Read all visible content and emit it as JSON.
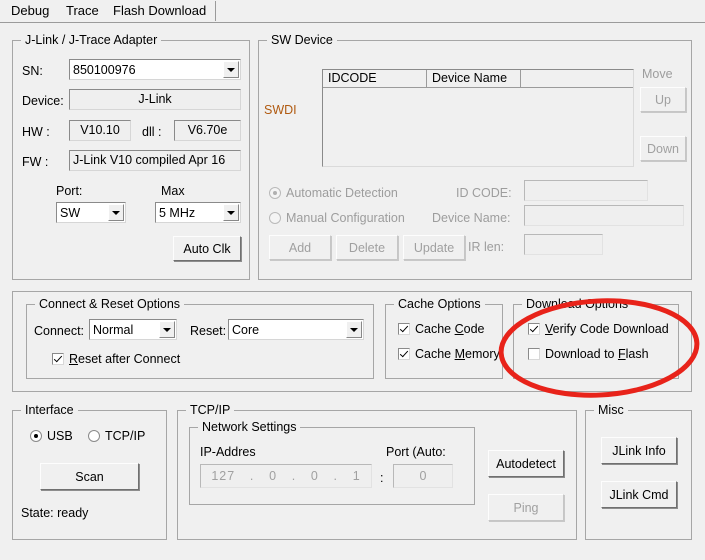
{
  "tabs": [
    {
      "label": "Debug",
      "active": true
    },
    {
      "label": "Trace",
      "active": false
    },
    {
      "label": "Flash Download",
      "active": false
    }
  ],
  "jlink_adapter": {
    "title": "J-Link / J-Trace Adapter",
    "sn_label": "SN:",
    "sn_value": "850100976",
    "device_label": "Device:",
    "device_value": "J-Link",
    "hw_label": "HW :",
    "hw_value": "V10.10",
    "dll_label": "dll :",
    "dll_value": "V6.70e",
    "fw_label": "FW :",
    "fw_value": "J-Link V10 compiled Apr 16",
    "port_label": "Port:",
    "port_value": "SW",
    "max_label": "Max",
    "max_value": "5 MHz",
    "auto_clk_label": "Auto Clk"
  },
  "sw_device": {
    "title": "SW Device",
    "swdio_label": "SWDI",
    "columns": [
      "IDCODE",
      "Device Name",
      ""
    ],
    "rows": [],
    "move_label": "Move",
    "up_label": "Up",
    "down_label": "Down",
    "automatic_detection_label": "Automatic Detection",
    "manual_configuration_label": "Manual Configuration",
    "detection_mode": "automatic",
    "id_code_label": "ID CODE:",
    "id_code_value": "",
    "device_name_label": "Device Name:",
    "device_name_value": "",
    "ir_len_label": "IR len:",
    "ir_len_value": "",
    "add_label": "Add",
    "delete_label": "Delete",
    "update_label": "Update"
  },
  "connect_reset": {
    "title": "Connect & Reset Options",
    "connect_label": "Connect:",
    "connect_value": "Normal",
    "reset_label": "Reset:",
    "reset_value": "Core",
    "reset_after_connect": {
      "label_pre": "",
      "accel": "R",
      "label_post": "eset after Connect",
      "checked": true
    }
  },
  "cache_options": {
    "title": "Cache Options",
    "cache_code": {
      "label_pre": "Cache ",
      "accel": "C",
      "label_post": "ode",
      "checked": true
    },
    "cache_memory": {
      "label_pre": "Cache ",
      "accel": "M",
      "label_post": "emory",
      "checked": true
    }
  },
  "download_options": {
    "title": "Download Options",
    "verify_code_download": {
      "label_pre": "",
      "accel": "V",
      "label_post": "erify Code Download",
      "checked": true
    },
    "download_to_flash": {
      "label_pre": "Download to ",
      "accel": "F",
      "label_post": "lash",
      "checked": false
    }
  },
  "interface": {
    "title": "Interface",
    "usb_label": "USB",
    "tcpip_label": "TCP/IP",
    "selected": "USB",
    "scan_label": "Scan",
    "state_label": "State: ready"
  },
  "tcpip": {
    "title": "TCP/IP",
    "network_settings_title": "Network Settings",
    "ip_address_label": "IP-Addres",
    "ip_octets": [
      "127",
      "0",
      "0",
      "1"
    ],
    "port_label": "Port (Auto:",
    "port_separator": ":",
    "port_value": "0",
    "autodetect_label": "Autodetect",
    "ping_label": "Ping"
  },
  "misc": {
    "title": "Misc",
    "jlink_info_label": "JLink Info",
    "jlink_cmd_label": "JLink Cmd"
  },
  "annotation": {
    "shape": "ellipse",
    "color": "#e8231a",
    "target": "download-options"
  }
}
